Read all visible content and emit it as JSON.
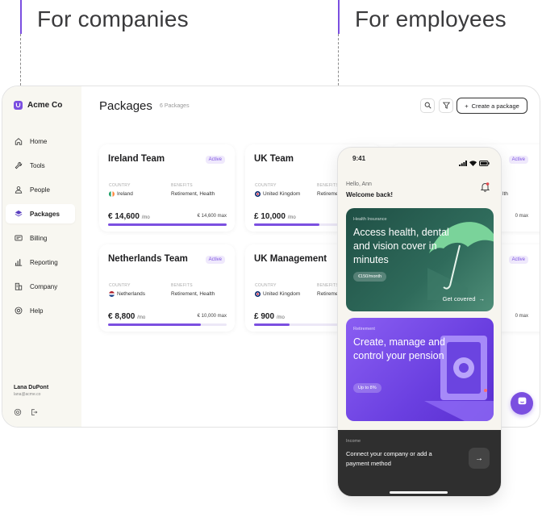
{
  "headings": {
    "companies": "For companies",
    "employees": "For employees"
  },
  "colors": {
    "accent": "#7b4fe0",
    "sidebar_bg": "#f8f7f1",
    "health_card": "#2f6b5b",
    "pension_card": "#6a3fe0",
    "income_bg": "#2f2f2f"
  },
  "dashboard": {
    "brand": "Acme Co",
    "nav": [
      {
        "label": "Home",
        "icon": "home-icon"
      },
      {
        "label": "Tools",
        "icon": "wrench-icon"
      },
      {
        "label": "People",
        "icon": "people-icon"
      },
      {
        "label": "Packages",
        "icon": "layers-icon",
        "active": true
      },
      {
        "label": "Billing",
        "icon": "billing-icon"
      },
      {
        "label": "Reporting",
        "icon": "chart-icon"
      },
      {
        "label": "Company",
        "icon": "building-icon"
      },
      {
        "label": "Help",
        "icon": "help-icon"
      }
    ],
    "user": {
      "name": "Lana DuPont",
      "email": "lana@acme.co"
    },
    "title": "Packages",
    "count": "6 Packages",
    "create_label": "Create a package",
    "cards": [
      {
        "title": "Ireland Team",
        "status": "Active",
        "country_label": "COUNTRY",
        "country": "Ireland",
        "benefits_label": "BENEFITS",
        "benefits": "Retirement, Health",
        "amount": "€ 14,600",
        "per": "/mo",
        "max": "€ 14,600 max",
        "progress": 1.0
      },
      {
        "title": "UK Team",
        "status": "Active",
        "country_label": "COUNTRY",
        "country": "United Kingdom",
        "benefits_label": "BENEFITS",
        "benefits": "Retirement, Health",
        "amount": "£ 10,000",
        "per": "/mo",
        "max": "",
        "progress": 0.55
      },
      {
        "title": "Netherlands Team",
        "status": "Active",
        "country_label": "COUNTRY",
        "country": "Netherlands",
        "benefits_label": "BENEFITS",
        "benefits": "Retirement, Health",
        "amount": "€ 8,800",
        "per": "/mo",
        "max": "€ 10,000 max",
        "progress": 0.78
      },
      {
        "title": "UK Management",
        "status": "Active",
        "country_label": "COUNTRY",
        "country": "United Kingdom",
        "benefits_label": "BENEFITS",
        "benefits": "Retirement, Health",
        "amount": "£ 900",
        "per": "/mo",
        "max": "",
        "progress": 0.3
      }
    ],
    "partial": {
      "badge1": "Active",
      "badge2": "Active",
      "text1": "lth",
      "max1": "0 max",
      "max2": "0 max"
    }
  },
  "phone": {
    "time": "9:41",
    "hello": "Hello, Ann",
    "welcome": "Welcome back!",
    "health": {
      "kicker": "Health Insurance",
      "title": "Access health, dental  and vision cover in minutes",
      "pill": "€150/month",
      "cta": "Get covered"
    },
    "pension": {
      "kicker": "Retirement",
      "title": "Create, manage and control your pension",
      "pill": "Up to 8%"
    },
    "income": {
      "label": "Income",
      "text": "Connect your company or add a payment method"
    }
  }
}
